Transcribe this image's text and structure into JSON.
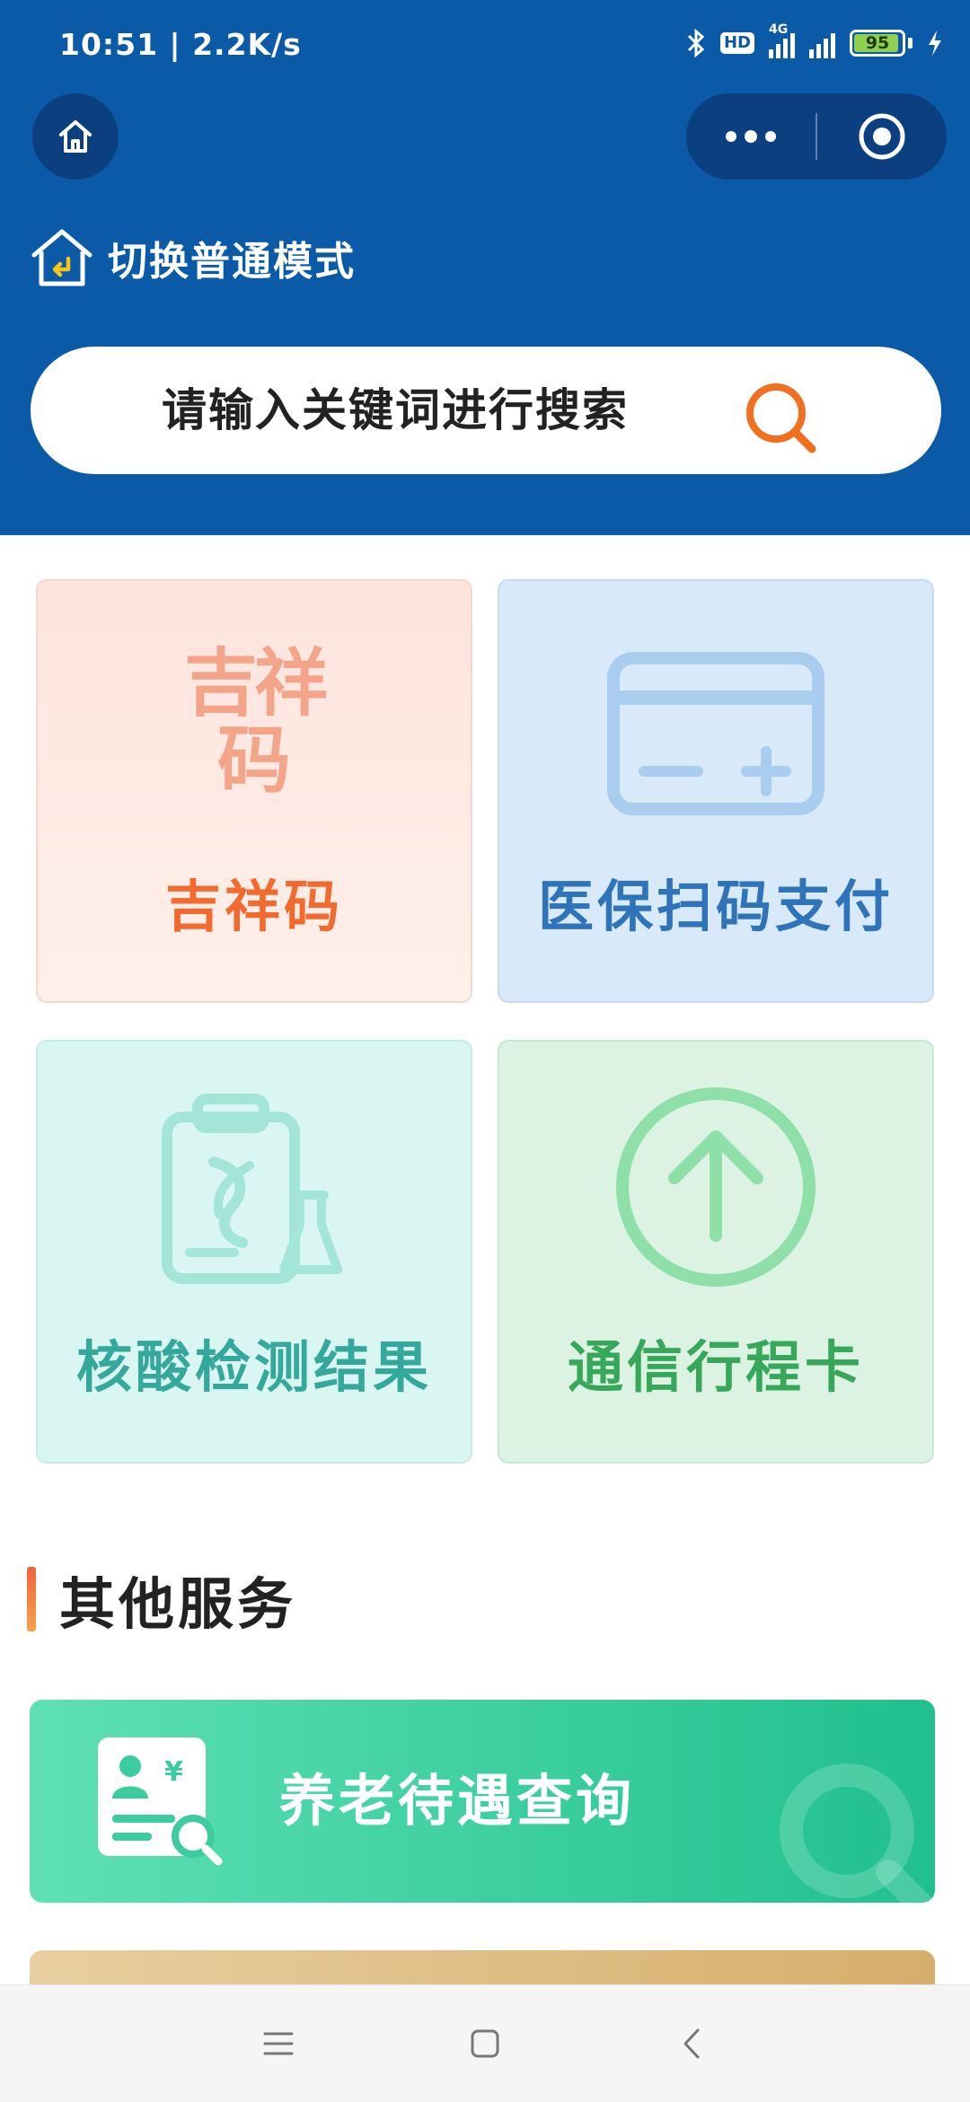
{
  "status_bar": {
    "time_speed": "10:51 | 2.2K/s",
    "hd_badge": "HD",
    "network": "4G",
    "battery_text": "95",
    "battery_level_percent": 95
  },
  "header": {
    "home_icon": "home-icon",
    "more_icon": "more-dots-icon",
    "close_icon": "target-close-icon",
    "mode_switch_label": "切换普通模式"
  },
  "search": {
    "placeholder": "请输入关键词进行搜索",
    "icon": "search-icon"
  },
  "cards": [
    {
      "label": "吉祥码",
      "icon": "jixiang-code-icon",
      "color": "#f26a2e"
    },
    {
      "label": "医保扫码支付",
      "icon": "medical-card-icon",
      "color": "#2f73b8"
    },
    {
      "label": "核酸检测结果",
      "icon": "test-report-icon",
      "color": "#34a89a"
    },
    {
      "label": "通信行程卡",
      "icon": "up-arrow-circle-icon",
      "color": "#37a85a"
    }
  ],
  "jxm_logo": {
    "text_top": "吉祥",
    "text_bottom": "码"
  },
  "section": {
    "title": "其他服务"
  },
  "banners": [
    {
      "label": "养老待遇查询",
      "icon": "pension-doc-icon",
      "currency": "¥"
    }
  ],
  "nav": {
    "menu_icon": "menu-icon",
    "home_icon": "square-home-icon",
    "back_icon": "back-chevron-icon"
  }
}
